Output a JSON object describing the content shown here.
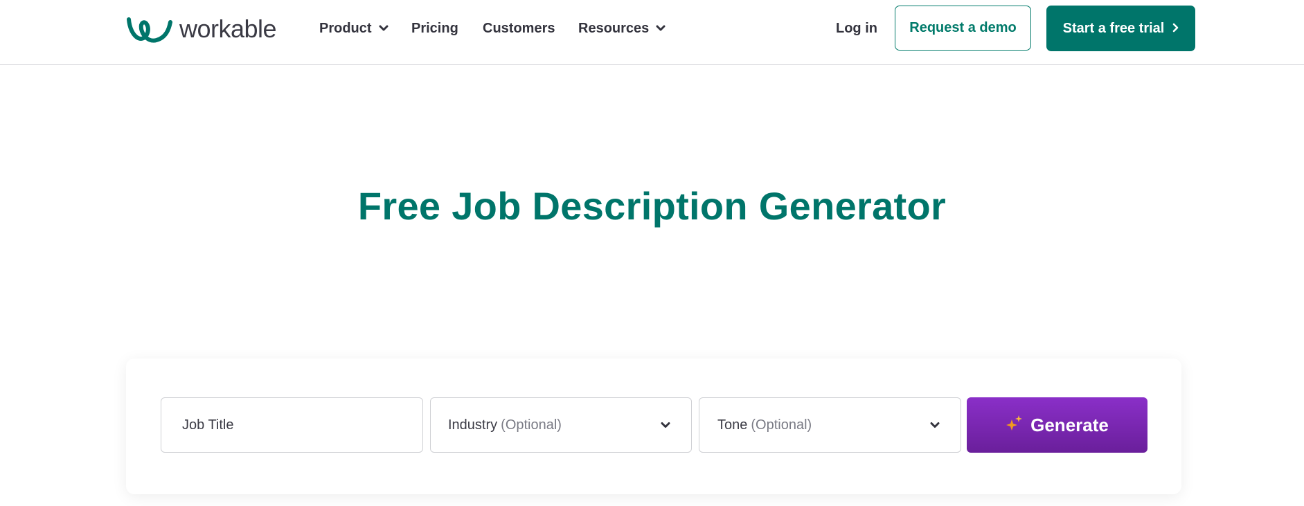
{
  "header": {
    "logo_text": "workable",
    "nav": [
      {
        "label": "Product",
        "has_dropdown": true
      },
      {
        "label": "Pricing",
        "has_dropdown": false
      },
      {
        "label": "Customers",
        "has_dropdown": false
      },
      {
        "label": "Resources",
        "has_dropdown": true
      }
    ],
    "login_label": "Log in",
    "demo_label": "Request a demo",
    "trial_label": "Start a free trial"
  },
  "hero": {
    "title": "Free Job Description Generator"
  },
  "generator": {
    "job_title_placeholder": "Job Title",
    "industry_label": "Industry",
    "industry_optional": "(Optional)",
    "tone_label": "Tone",
    "tone_optional": "(Optional)",
    "generate_label": "Generate"
  },
  "colors": {
    "brand_green": "#00756a",
    "generate_purple": "#7b27b5",
    "sparkle_orange": "#f29a1d"
  },
  "icons": {
    "logo": "workable-logo-icon",
    "dropdown": "chevron-down-icon",
    "trial_arrow": "chevron-right-icon",
    "generate": "sparkle-icon"
  }
}
